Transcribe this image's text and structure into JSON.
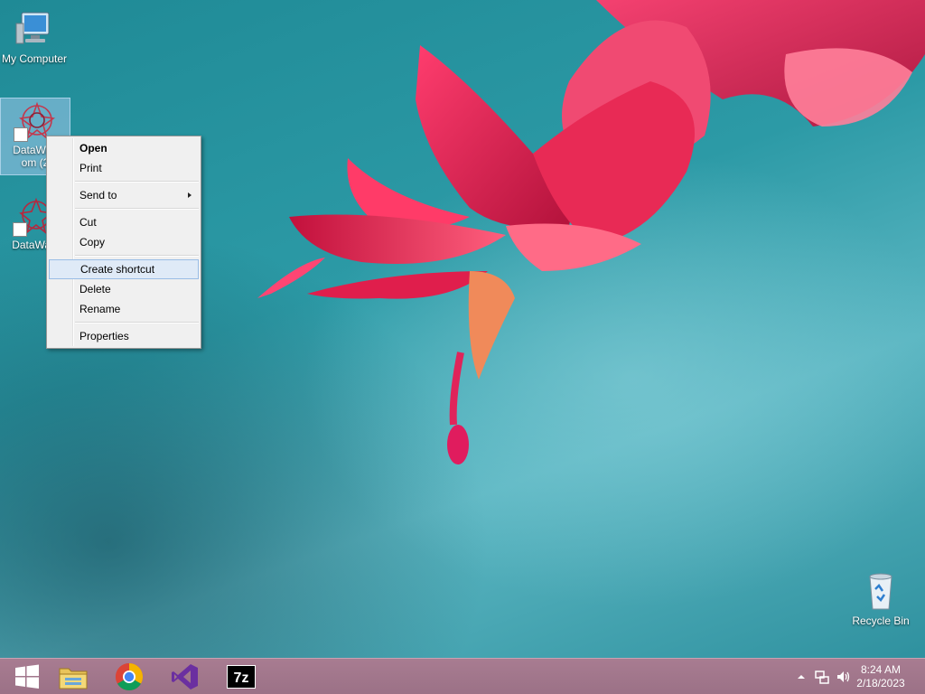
{
  "desktop": {
    "icons": [
      {
        "label": "My Computer"
      },
      {
        "label": "DataWag",
        "label_line2": "om (2"
      },
      {
        "label": "DataWag"
      },
      {
        "label": "Recycle Bin"
      }
    ]
  },
  "context_menu": {
    "items": [
      {
        "label": "Open"
      },
      {
        "label": "Print"
      },
      {
        "label": "Send to"
      },
      {
        "label": "Cut"
      },
      {
        "label": "Copy"
      },
      {
        "label": "Create shortcut"
      },
      {
        "label": "Delete"
      },
      {
        "label": "Rename"
      },
      {
        "label": "Properties"
      }
    ]
  },
  "taskbar": {
    "items": [
      "start-icon",
      "file-explorer-icon",
      "chrome-icon",
      "visual-studio-icon",
      "7zip-icon"
    ],
    "sevenzip_text": "7z"
  },
  "tray": {
    "time": "8:24 AM",
    "date": "2/18/2023"
  },
  "colors": {
    "taskbar": "#9b7186",
    "menu_highlight": "#dfeaf7",
    "flower": "#e0244f"
  }
}
